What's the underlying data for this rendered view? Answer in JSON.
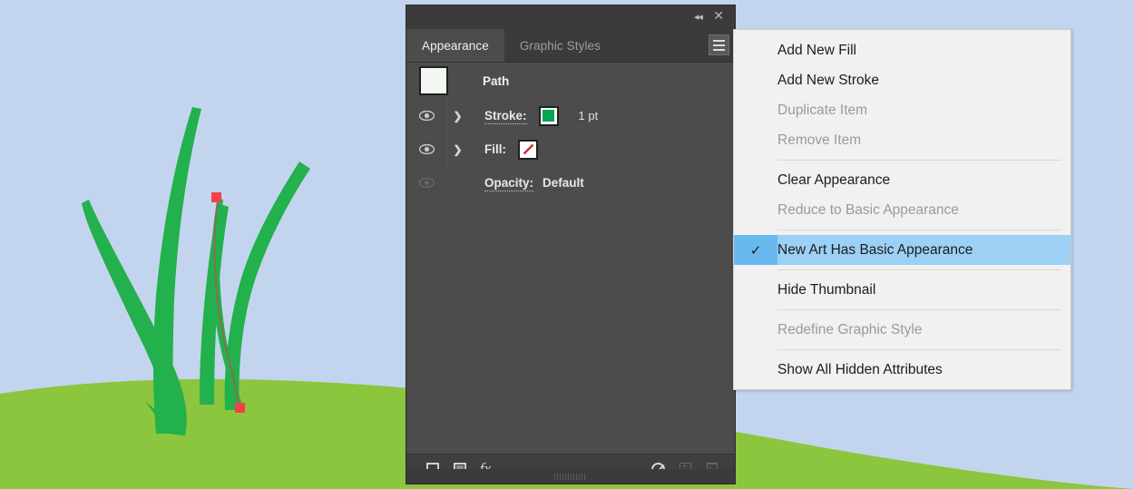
{
  "artwork": {
    "sky_color": "#c3d5ee",
    "grass_color": "#8cc63e",
    "blade_color": "#22b14c",
    "selected_path_color": "#8b6d4e",
    "anchor_color": "#f4404a",
    "description": "Illustration of green grass blades on a hill against a blue sky, with one blade path selected showing anchor points"
  },
  "panel": {
    "titlebar": {
      "collapse_label": "◂◂",
      "close_label": "✕"
    },
    "tabs": [
      {
        "label": "Appearance",
        "active": true
      },
      {
        "label": "Graphic Styles",
        "active": false
      }
    ],
    "menu_button_label": "Panel menu",
    "rows": {
      "thumbnail_label": "Path",
      "stroke": {
        "label": "Stroke:",
        "swatch_color": "#00a651",
        "value": "1 pt"
      },
      "fill": {
        "label": "Fill:",
        "swatch_color": "none",
        "swatch_none_color": "#d0293a"
      },
      "opacity": {
        "label": "Opacity:",
        "value": "Default"
      }
    },
    "footer": {
      "add_new_stroke_icon": "square-outline-icon",
      "add_new_fill_icon": "square-filled-icon",
      "add_new_effect_icon": "fx-icon",
      "fx_label": "fx.",
      "clear_appearance_icon": "no-symbol-icon",
      "duplicate_item_icon": "duplicate-icon",
      "delete_item_icon": "trash-icon"
    }
  },
  "flyout_menu": {
    "items": [
      {
        "label": "Add New Fill",
        "state": "enabled",
        "checked": false,
        "separator_after": false
      },
      {
        "label": "Add New Stroke",
        "state": "enabled",
        "checked": false,
        "separator_after": false
      },
      {
        "label": "Duplicate Item",
        "state": "disabled",
        "checked": false,
        "separator_after": false
      },
      {
        "label": "Remove Item",
        "state": "disabled",
        "checked": false,
        "separator_after": true
      },
      {
        "label": "Clear Appearance",
        "state": "enabled",
        "checked": false,
        "separator_after": false
      },
      {
        "label": "Reduce to Basic Appearance",
        "state": "disabled",
        "checked": false,
        "separator_after": true
      },
      {
        "label": "New Art Has Basic Appearance",
        "state": "selected",
        "checked": true,
        "separator_after": true
      },
      {
        "label": "Hide Thumbnail",
        "state": "enabled",
        "checked": false,
        "separator_after": true
      },
      {
        "label": "Redefine Graphic Style",
        "state": "disabled",
        "checked": false,
        "separator_after": true
      },
      {
        "label": "Show All Hidden Attributes",
        "state": "enabled",
        "checked": false,
        "separator_after": false
      }
    ],
    "check_glyph": "✓",
    "highlight_color": "#9cd0f5",
    "check_cell_color": "#69b9f0"
  }
}
